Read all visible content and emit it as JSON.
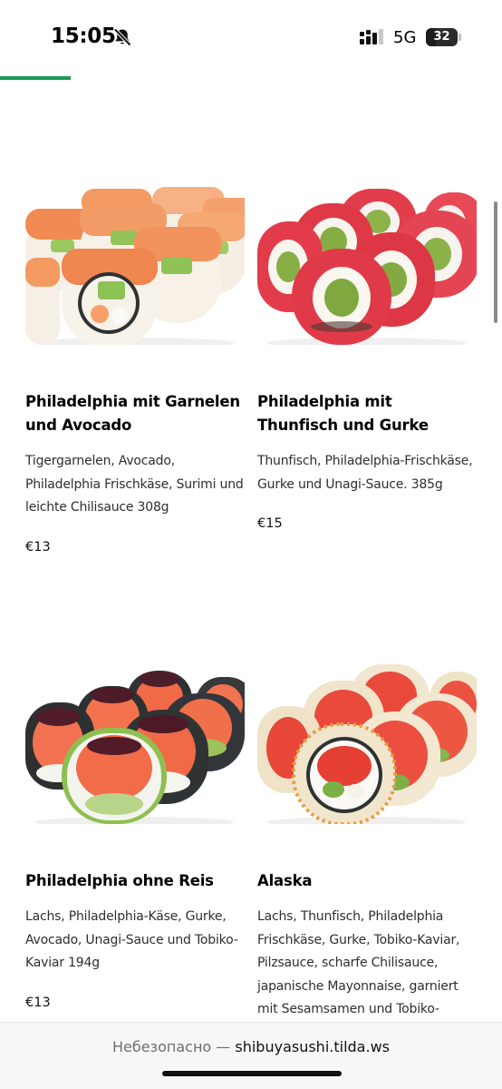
{
  "status_bar": {
    "time": "15:05",
    "network": "5G",
    "battery_level": "32",
    "battery_fraction": 0.32,
    "icons": [
      "bell-slash-icon",
      "signal-icon",
      "battery-icon"
    ]
  },
  "loading_progress": 0.14,
  "colors": {
    "accent": "#1a9a57",
    "rice": "#f4f1ea",
    "salmon": "#f0704a",
    "tuna": "#e8434e",
    "avocado": "#8dc05a",
    "nori": "#2f3233",
    "roe": "#e98a3a"
  },
  "products": [
    {
      "title": "Philadelphia mit Garnelen und Avocado",
      "description": "Tigergarnelen, Avocado, Philadelphia Frischkäse, Surimi und leichte Chilisauce 308g",
      "price": "€13"
    },
    {
      "title": "Philadelphia mit Thunfisch und Gurke",
      "description": "Thunfisch, Philadelphia-Frischkäse, Gurke und Unagi-Sauce. 385g",
      "price": "€15"
    },
    {
      "title": "Philadelphia ohne Reis",
      "description": "Lachs, Philadelphia-Käse, Gurke, Avocado, Unagi-Sauce und Tobiko-Kaviar 194g",
      "price": "€13"
    },
    {
      "title": "Alaska",
      "description": "Lachs, Thunfisch, Philadelphia Frischkäse, Gurke, Tobiko-Kaviar, Pilzsauce, scharfe Chilisauce, japanische Mayonnaise, garniert mit Sesamsamen und Tobiko-Kaviar",
      "price": ""
    }
  ],
  "url_bar": {
    "prefix": "Небезопасно —",
    "domain": "shibuyasushi.tilda.ws"
  }
}
